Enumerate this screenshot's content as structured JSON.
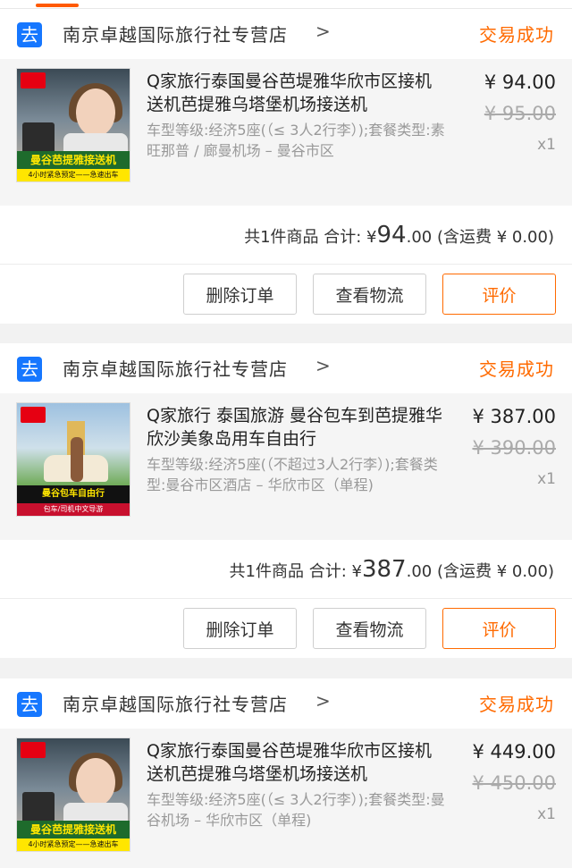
{
  "colors": {
    "accent": "#ff6a00",
    "shop_icon": "#1677ff"
  },
  "orders": [
    {
      "shop_name": "南京卓越国际旅行社专营店",
      "status": "交易成功",
      "item": {
        "title": "Q家旅行泰国曼谷芭堤雅华欣市区接机送机芭提雅乌塔堡机场接送机",
        "spec": "车型等级:经济5座(（≤ 3人2行李）);套餐类型:素旺那普 / 廊曼机场 – 曼谷市区",
        "price": "¥ 94.00",
        "original_price": "¥ 95.00",
        "quantity": "x1",
        "thumb_banner": "曼谷芭提雅接送机",
        "thumb_strip": "4小时紧急预定——急速出车"
      },
      "summary": {
        "count_label": "共1件商品 合计: ¥",
        "amount_int": "94",
        "amount_dec": ".00",
        "shipping": "(含运费 ¥ 0.00)"
      },
      "buttons": {
        "delete": "删除订单",
        "logistics": "查看物流",
        "review": "评价"
      }
    },
    {
      "shop_name": "南京卓越国际旅行社专营店",
      "status": "交易成功",
      "item": {
        "title": "Q家旅行 泰国旅游 曼谷包车到芭提雅华欣沙美象岛用车自由行",
        "spec": "车型等级:经济5座(（不超过3人2行李）);套餐类型:曼谷市区酒店 – 华欣市区（单程)",
        "price": "¥ 387.00",
        "original_price": "¥ 390.00",
        "quantity": "x1",
        "thumb_banner": "曼谷包车自由行",
        "thumb_strip": "包车/司机中文导游"
      },
      "summary": {
        "count_label": "共1件商品 合计: ¥",
        "amount_int": "387",
        "amount_dec": ".00",
        "shipping": "(含运费 ¥ 0.00)"
      },
      "buttons": {
        "delete": "删除订单",
        "logistics": "查看物流",
        "review": "评价"
      }
    },
    {
      "shop_name": "南京卓越国际旅行社专营店",
      "status": "交易成功",
      "item": {
        "title": "Q家旅行泰国曼谷芭堤雅华欣市区接机送机芭提雅乌塔堡机场接送机",
        "spec": "车型等级:经济5座(（≤ 3人2行李）);套餐类型:曼谷机场 – 华欣市区（单程)",
        "price": "¥ 449.00",
        "original_price": "¥ 450.00",
        "quantity": "x1",
        "thumb_banner": "曼谷芭提雅接送机",
        "thumb_strip": "4小时紧急预定——急速出车"
      }
    }
  ]
}
